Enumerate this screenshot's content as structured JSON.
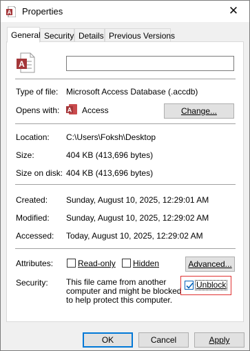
{
  "window": {
    "title": "Properties",
    "close_glyph": "✕"
  },
  "tabs": [
    {
      "label": "General",
      "active": true
    },
    {
      "label": "Security"
    },
    {
      "label": "Details"
    },
    {
      "label": "Previous Versions"
    }
  ],
  "file": {
    "icon": "access-file-icon",
    "name_value": ""
  },
  "info": {
    "type_label": "Type of file:",
    "type_value": "Microsoft Access Database (.accdb)",
    "opens_label": "Opens with:",
    "opens_value": "Access",
    "change_button": "Change...",
    "location_label": "Location:",
    "location_value": "C:\\Users\\Foksh\\Desktop",
    "size_label": "Size:",
    "size_value": "404 KB (413,696 bytes)",
    "size_on_disk_label": "Size on disk:",
    "size_on_disk_value": "404 KB (413,696 bytes)",
    "created_label": "Created:",
    "created_value": "Sunday, August 10, 2025, 12:29:01 AM",
    "modified_label": "Modified:",
    "modified_value": "Sunday, August 10, 2025, 12:29:02 AM",
    "accessed_label": "Accessed:",
    "accessed_value": "Today, August 10, 2025, 12:29:02 AM"
  },
  "attributes": {
    "label": "Attributes:",
    "readonly_label": "Read-only",
    "readonly_checked": false,
    "hidden_label": "Hidden",
    "hidden_checked": false,
    "advanced_button": "Advanced..."
  },
  "security": {
    "label": "Security:",
    "text": "This file came from another computer and might be blocked to help protect this computer.",
    "unblock_label": "Unblock",
    "unblock_checked": true
  },
  "footer": {
    "ok": "OK",
    "cancel": "Cancel",
    "apply": "Apply"
  },
  "colors": {
    "access_red": "#a4373a",
    "focus_blue": "#0078d7",
    "highlight_red": "#e03030"
  }
}
